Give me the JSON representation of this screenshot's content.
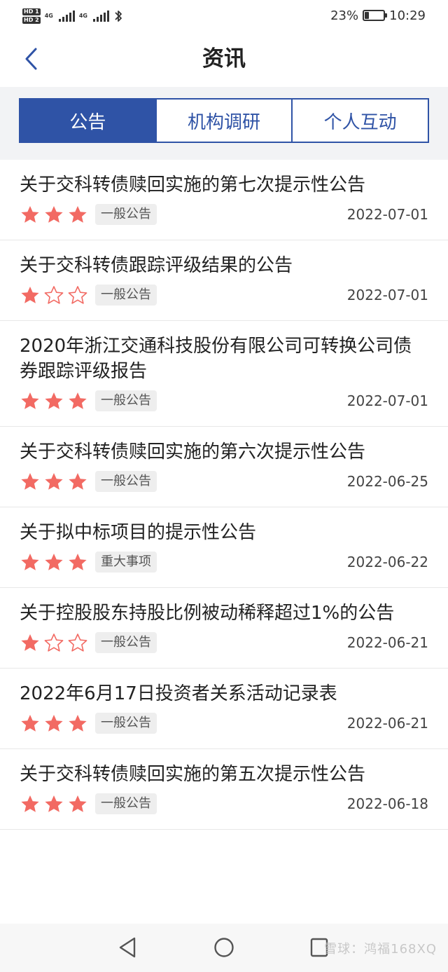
{
  "status_bar": {
    "hd1": "HD 1",
    "hd2": "HD 2",
    "net1": "4G",
    "net2": "4G",
    "battery_text": "23%",
    "battery_level": 0.23,
    "time": "10:29"
  },
  "nav": {
    "title": "资讯"
  },
  "tabs": [
    {
      "label": "公告",
      "active": true
    },
    {
      "label": "机构调研",
      "active": false
    },
    {
      "label": "个人互动",
      "active": false
    }
  ],
  "items": [
    {
      "title": "关于交科转债赎回实施的第七次提示性公告",
      "stars": 3,
      "badge": "一般公告",
      "date": "2022-07-01"
    },
    {
      "title": "关于交科转债跟踪评级结果的公告",
      "stars": 1,
      "badge": "一般公告",
      "date": "2022-07-01"
    },
    {
      "title": "2020年浙江交通科技股份有限公司可转换公司债券跟踪评级报告",
      "stars": 3,
      "badge": "一般公告",
      "date": "2022-07-01"
    },
    {
      "title": "关于交科转债赎回实施的第六次提示性公告",
      "stars": 3,
      "badge": "一般公告",
      "date": "2022-06-25"
    },
    {
      "title": "关于拟中标项目的提示性公告",
      "stars": 3,
      "badge": "重大事项",
      "date": "2022-06-22"
    },
    {
      "title": "关于控股股东持股比例被动稀释超过1%的公告",
      "stars": 1,
      "badge": "一般公告",
      "date": "2022-06-21"
    },
    {
      "title": "2022年6月17日投资者关系活动记录表",
      "stars": 3,
      "badge": "一般公告",
      "date": "2022-06-21"
    },
    {
      "title": "关于交科转债赎回实施的第五次提示性公告",
      "stars": 3,
      "badge": "一般公告",
      "date": "2022-06-18"
    }
  ],
  "max_stars": 3,
  "colors": {
    "accent": "#2f53a6",
    "star_filled": "#f26a63",
    "star_empty_stroke": "#f26a63"
  },
  "watermark": "雪球：鸿福168XQ"
}
